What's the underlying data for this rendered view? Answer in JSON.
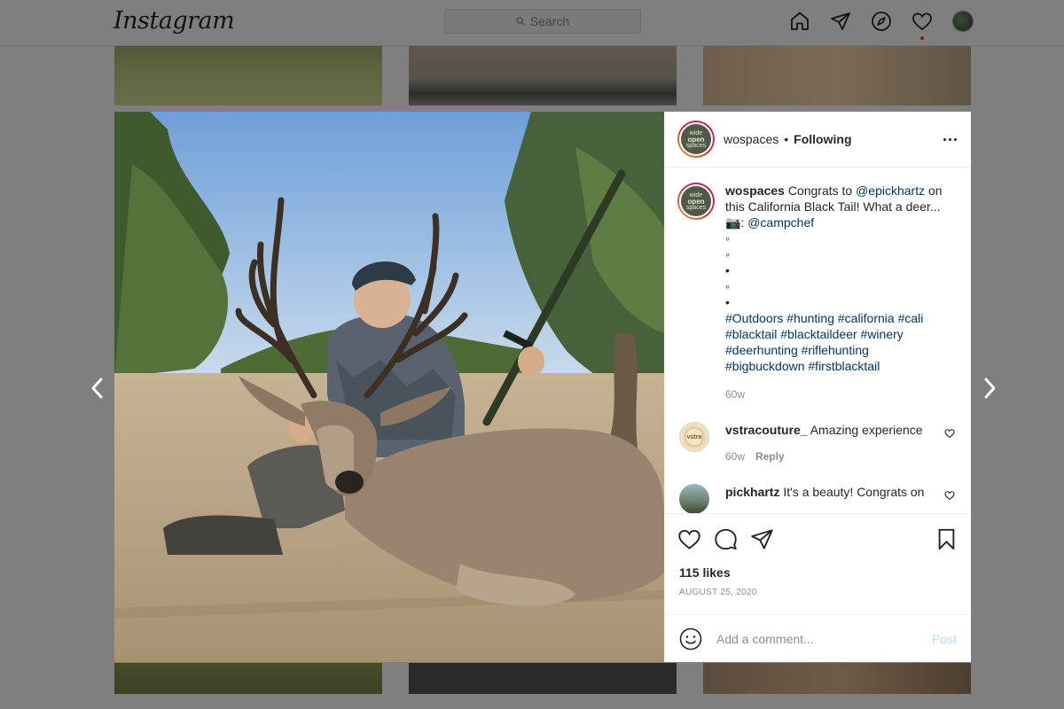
{
  "topbar": {
    "logo": "Instagram",
    "search_placeholder": "Search",
    "icons": [
      "home-icon",
      "direct-icon",
      "explore-icon",
      "activity-heart-icon",
      "profile-avatar"
    ]
  },
  "post": {
    "header": {
      "username": "wospaces",
      "separator": "•",
      "follow_status": "Following",
      "avatar_text_top": "wide",
      "avatar_text_mid": "open",
      "avatar_text_bot": "spaces"
    },
    "caption": {
      "username": "wospaces",
      "text_1": " Congrats to ",
      "mention_1": "@epickhartz",
      "text_2": " on this California Black Tail! What a deer...",
      "camera_emoji": "📷",
      "text_3": ": ",
      "mention_2": "@campchef",
      "dots": [
        "◦",
        "◦",
        "•",
        "◦",
        "•"
      ],
      "hashtags": "#Outdoors #hunting #california #cali #blacktail #blacktaildeer #winery #deerhunting #riflehunting #bigbuckdown #firstblacktail",
      "time": "60w"
    },
    "comments": [
      {
        "username": "vstracouture_",
        "text": " Amazing experience",
        "time": "60w",
        "reply": "Reply",
        "avatar_text": "vstra"
      },
      {
        "username": "pickhartz",
        "text": " It's a beauty! Congrats on"
      }
    ],
    "likes": "115 likes",
    "date": "AUGUST 25, 2020",
    "add_comment_placeholder": "Add a comment...",
    "post_button": "Post"
  },
  "colors": {
    "link": "#00376b",
    "post_button": "#b2dffc",
    "muted": "#8e8e8e",
    "story_ring": "#dc2743"
  }
}
